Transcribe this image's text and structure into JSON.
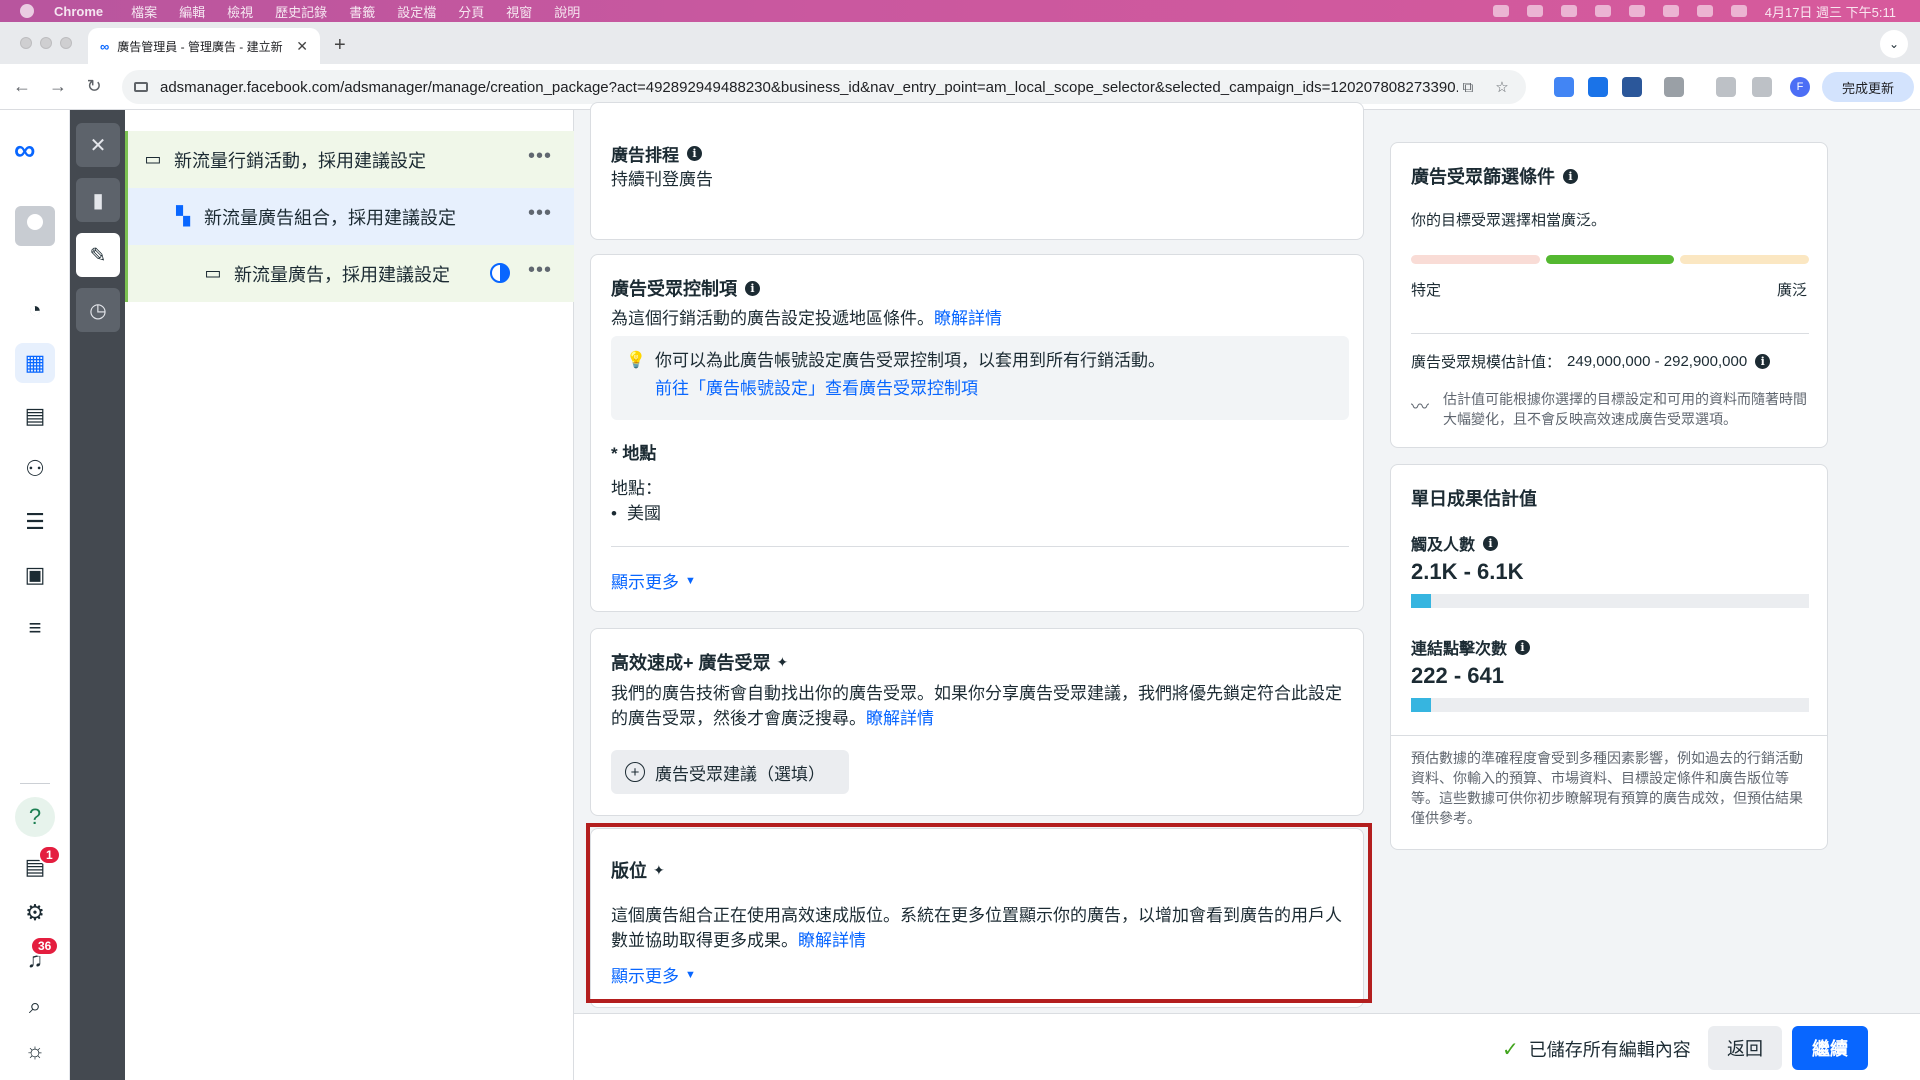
{
  "menubar": {
    "app": "Chrome",
    "items": [
      "檔案",
      "編輯",
      "檢視",
      "歷史記錄",
      "書籤",
      "設定檔",
      "分頁",
      "視窗",
      "說明"
    ],
    "clock": "4月17日 週三 下午5:11"
  },
  "browser": {
    "tab_title": "廣告管理員 - 管理廣告 - 建立新",
    "url": "adsmanager.facebook.com/adsmanager/manage/creation_package?act=492892949488230&business_id&nav_entry_point=am_local_scope_selector&selected_campaign_ids=120207808273390...",
    "update_label": "完成更新",
    "profile_initial": "F"
  },
  "rail": {
    "notif_badge": "1",
    "alert_badge": "36"
  },
  "tree": {
    "campaign": "新流量行銷活動，採用建議設定",
    "adset": "新流量廣告組合，採用建議設定",
    "ad": "新流量廣告，採用建議設定"
  },
  "schedule": {
    "title": "廣告排程",
    "value": "持續刊登廣告"
  },
  "audience_controls": {
    "title": "廣告受眾控制項",
    "desc": "為這個行銷活動的廣告設定投遞地區條件。",
    "learn_more": "瞭解詳情",
    "tip": "你可以為此廣告帳號設定廣告受眾控制項，以套用到所有行銷活動。",
    "tip_link": "前往「廣告帳號設定」查看廣告受眾控制項",
    "location_header": "* 地點",
    "location_label": "地點：",
    "location_value": "美國",
    "show_more": "顯示更多"
  },
  "advantage_audience": {
    "title": "高效速成+ 廣告受眾",
    "desc": "我們的廣告技術會自動找出你的廣告受眾。如果你分享廣告受眾建議，我們將優先鎖定符合此設定的廣告受眾，然後才會廣泛搜尋。",
    "learn_more": "瞭解詳情",
    "suggest_button": "廣告受眾建議（選填）"
  },
  "placements": {
    "title": "版位",
    "desc": "這個廣告組合正在使用高效速成版位。系統在更多位置顯示你的廣告，以增加會看到廣告的用戶人數並協助取得更多成果。",
    "learn_more": "瞭解詳情",
    "show_more": "顯示更多"
  },
  "audience_definition": {
    "title": "廣告受眾篩選條件",
    "summary": "你的目標受眾選擇相當廣泛。",
    "specific": "特定",
    "broad": "廣泛",
    "size_label": "廣告受眾規模估計值：",
    "size_value": "249,000,000 - 292,900,000",
    "disclaimer": "估計值可能根據你選擇的目標設定和可用的資料而隨著時間大幅變化，且不會反映高效速成廣告受眾選項。",
    "meter_colors": [
      "#f9dcd6",
      "#54b830",
      "#fbe7c2"
    ]
  },
  "daily_results": {
    "title": "單日成果估計值",
    "reach_label": "觸及人數",
    "reach_value": "2.1K - 6.1K",
    "reach_fill": 0.05,
    "clicks_label": "連結點擊次數",
    "clicks_value": "222 - 641",
    "clicks_fill": 0.05,
    "note": "預估數據的準確程度會受到多種因素影響，例如過去的行銷活動資料、你輸入的預算、市場資料、目標設定條件和廣告版位等等。這些數據可供你初步瞭解現有預算的廣告成效，但預估結果僅供參考。"
  },
  "actions": {
    "saved": "已儲存所有編輯內容",
    "back": "返回",
    "continue": "繼續"
  }
}
